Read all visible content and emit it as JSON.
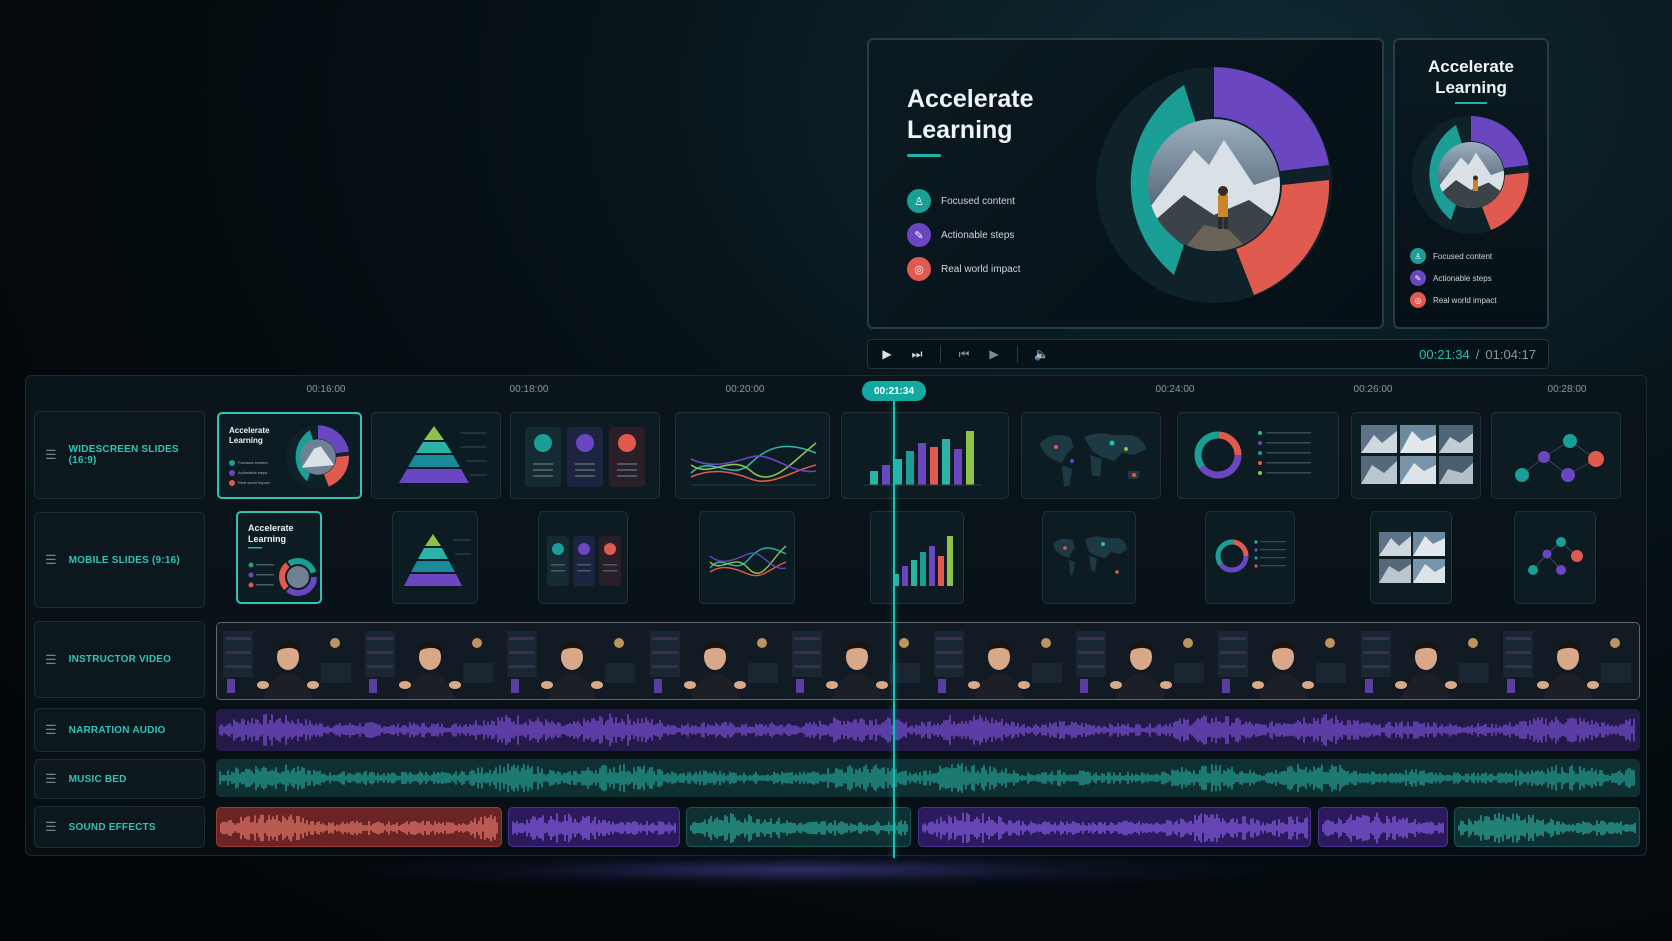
{
  "preview": {
    "wide": {
      "title_line1": "Accelerate",
      "title_line2": "Learning",
      "bullets": [
        {
          "label": "Focused content",
          "color": "#1a9e96",
          "icon": "person-icon"
        },
        {
          "label": "Actionable steps",
          "color": "#6b46c1",
          "icon": "pencil-icon"
        },
        {
          "label": "Real world impact",
          "color": "#e05a4f",
          "icon": "target-icon"
        }
      ]
    },
    "mobile": {
      "title_line1": "Accelerate",
      "title_line2": "Learning",
      "bullets": [
        {
          "label": "Focused content",
          "color": "#1a9e96"
        },
        {
          "label": "Actionable steps",
          "color": "#6b46c1"
        },
        {
          "label": "Real world impact",
          "color": "#e05a4f"
        }
      ]
    }
  },
  "player": {
    "current_time": "00:21:34",
    "total_time": "01:04:17",
    "controls": [
      "play-icon",
      "next-frame-icon",
      "skip-back-icon",
      "play-small-icon",
      "volume-icon"
    ]
  },
  "timeline": {
    "playhead_label": "00:21:34",
    "ruler": [
      "00:16:00",
      "00:18:00",
      "00:20:00",
      "00:24:00",
      "00:26:00",
      "00:28:00"
    ],
    "tracks": [
      {
        "name": "WIDESCREEN SLIDES (16:9)"
      },
      {
        "name": "MOBILE SLIDES (9:16)"
      },
      {
        "name": "INSTRUCTOR VIDEO"
      },
      {
        "name": "NARRATION AUDIO"
      },
      {
        "name": "MUSIC BED"
      },
      {
        "name": "SOUND EFFECTS"
      }
    ],
    "widescreen_first_clip": {
      "title_line1": "Accelerate",
      "title_line2": "Learning",
      "bullets": [
        "Focused content",
        "Actionable steps",
        "Real world impact"
      ]
    },
    "mobile_first_clip": {
      "title_line1": "Accelerate",
      "title_line2": "Learning"
    }
  },
  "colors": {
    "accent": "#1fc2b6",
    "purple": "#6b46c1",
    "coral": "#e05a4f",
    "teal": "#1a9e96"
  }
}
